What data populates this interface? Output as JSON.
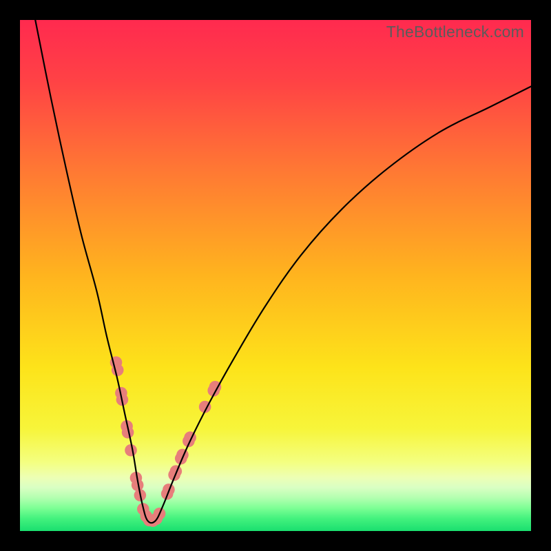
{
  "watermark": "TheBottleneck.com",
  "chart_data": {
    "type": "line",
    "title": "",
    "xlabel": "",
    "ylabel": "",
    "xlim": [
      0,
      100
    ],
    "ylim": [
      0,
      100
    ],
    "grid": false,
    "legend": false,
    "series": [
      {
        "name": "bottleneck-curve",
        "color": "#000000",
        "x": [
          3,
          6,
          9,
          12,
          15,
          17,
          19,
          20.5,
          22,
          23,
          24,
          25,
          26.5,
          28,
          30,
          33,
          37,
          42,
          48,
          55,
          63,
          72,
          82,
          92,
          100
        ],
        "y": [
          100,
          85,
          71,
          58,
          47,
          38,
          30,
          23,
          16,
          10,
          5,
          2,
          2,
          5,
          10,
          17,
          25,
          34,
          44,
          54,
          63,
          71,
          78,
          83,
          87
        ]
      }
    ],
    "markers": {
      "name": "highlight-dots",
      "color": "#e77e7b",
      "points": [
        {
          "x": 18.8,
          "y": 33.0
        },
        {
          "x": 19.1,
          "y": 31.5
        },
        {
          "x": 19.8,
          "y": 27.0
        },
        {
          "x": 20.0,
          "y": 25.7
        },
        {
          "x": 20.9,
          "y": 20.5
        },
        {
          "x": 21.1,
          "y": 19.3
        },
        {
          "x": 21.7,
          "y": 15.8
        },
        {
          "x": 22.7,
          "y": 10.4
        },
        {
          "x": 23.0,
          "y": 9.0
        },
        {
          "x": 23.5,
          "y": 7.0
        },
        {
          "x": 24.1,
          "y": 4.3
        },
        {
          "x": 24.7,
          "y": 2.9
        },
        {
          "x": 25.3,
          "y": 2.1
        },
        {
          "x": 26.0,
          "y": 2.0
        },
        {
          "x": 26.7,
          "y": 2.4
        },
        {
          "x": 27.3,
          "y": 3.4
        },
        {
          "x": 28.8,
          "y": 7.3
        },
        {
          "x": 29.1,
          "y": 8.1
        },
        {
          "x": 30.2,
          "y": 11.0
        },
        {
          "x": 30.5,
          "y": 11.7
        },
        {
          "x": 31.5,
          "y": 14.2
        },
        {
          "x": 31.8,
          "y": 14.9
        },
        {
          "x": 33.0,
          "y": 17.6
        },
        {
          "x": 33.3,
          "y": 18.3
        },
        {
          "x": 36.2,
          "y": 24.3
        },
        {
          "x": 37.9,
          "y": 27.5
        },
        {
          "x": 38.2,
          "y": 28.2
        }
      ]
    },
    "background": {
      "type": "vertical-gradient",
      "stops": [
        {
          "pos": 0.0,
          "color": "#ff2a4f"
        },
        {
          "pos": 0.12,
          "color": "#ff4245"
        },
        {
          "pos": 0.3,
          "color": "#ff7a33"
        },
        {
          "pos": 0.5,
          "color": "#ffb41e"
        },
        {
          "pos": 0.68,
          "color": "#fde31a"
        },
        {
          "pos": 0.8,
          "color": "#f7f53a"
        },
        {
          "pos": 0.865,
          "color": "#f4ff80"
        },
        {
          "pos": 0.895,
          "color": "#edffb4"
        },
        {
          "pos": 0.915,
          "color": "#d9ffc3"
        },
        {
          "pos": 0.935,
          "color": "#b3ffb0"
        },
        {
          "pos": 0.955,
          "color": "#7dff95"
        },
        {
          "pos": 0.975,
          "color": "#44f27e"
        },
        {
          "pos": 1.0,
          "color": "#1adf6f"
        }
      ]
    }
  }
}
